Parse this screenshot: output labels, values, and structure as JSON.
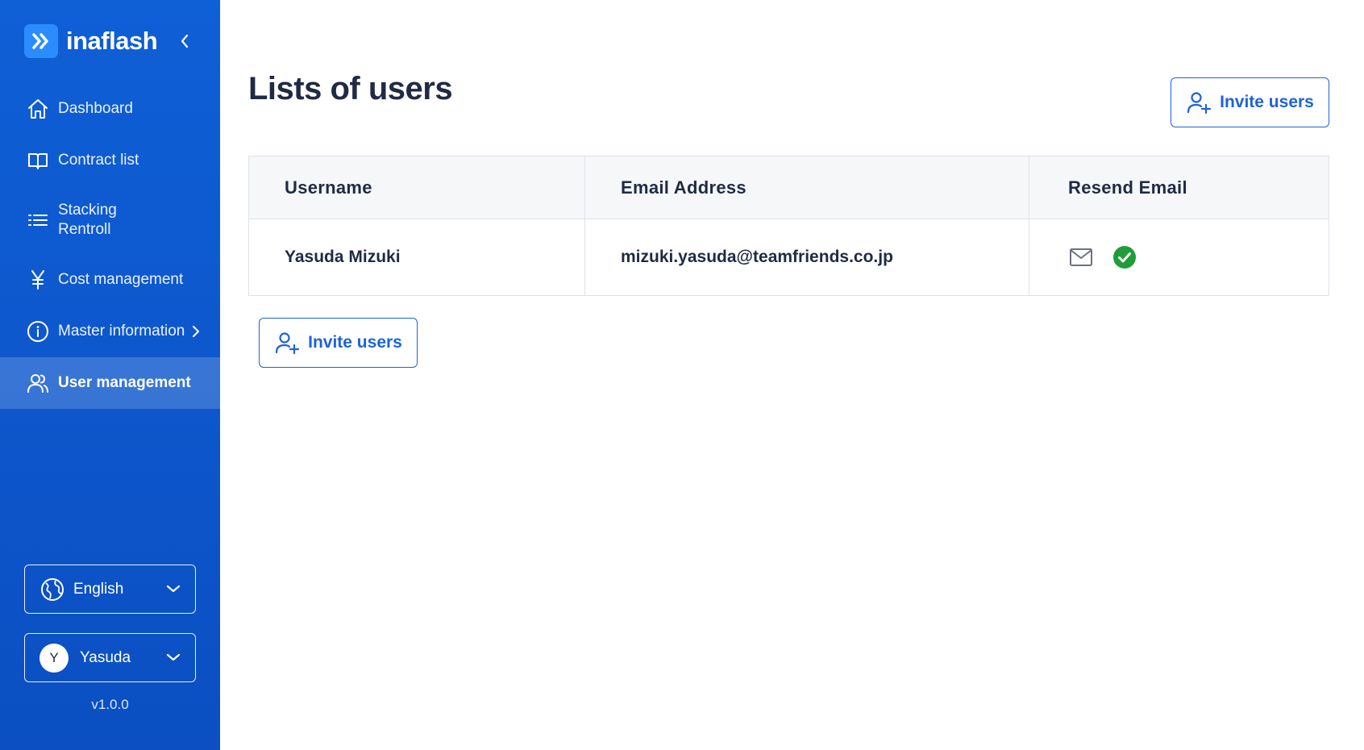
{
  "brand": {
    "name": "inaflash",
    "logo_icon": "double-chevron-right-icon",
    "accent": "#2b8cff"
  },
  "sidebar": {
    "background": "#0f5fd6",
    "items": [
      {
        "label": "Dashboard",
        "icon": "home-icon"
      },
      {
        "label": "Contract list",
        "icon": "book-icon"
      },
      {
        "label": "Stacking\nRentroll",
        "icon": "list-icon"
      },
      {
        "label": "Cost management",
        "icon": "yen-icon"
      },
      {
        "label": "Master information",
        "icon": "info-icon"
      },
      {
        "label": "User management",
        "icon": "users-icon",
        "active": true
      }
    ],
    "language": {
      "value": "English"
    },
    "user": {
      "initial": "Y",
      "name": "Yasuda"
    },
    "version": "v1.0.0"
  },
  "main": {
    "title": "Lists of users",
    "invite_label": "Invite users",
    "table": {
      "headers": [
        "Username",
        "Email Address",
        "Resend Email"
      ],
      "rows": [
        {
          "username": "Yasuda Mizuki",
          "email": "mizuki.yasuda@teamfriends.co.jp",
          "resend_icons": [
            "mail-icon",
            "check-circle-icon"
          ]
        }
      ]
    }
  },
  "colors": {
    "primary": "#1d63d8",
    "success": "#1f9d3a",
    "text": "#1f2a44",
    "border": "#dde2ea"
  }
}
